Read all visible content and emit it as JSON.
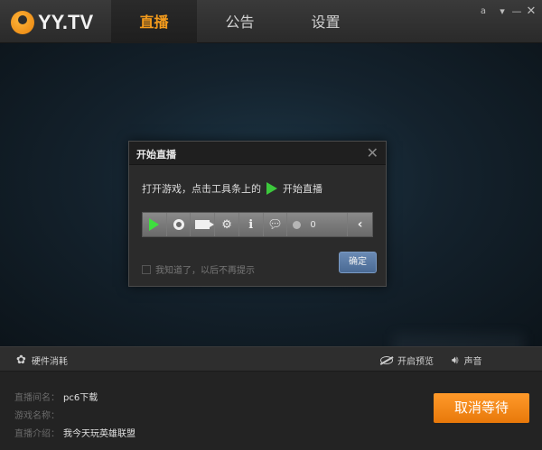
{
  "app": {
    "logo_text": "YY.TV"
  },
  "tabs": [
    {
      "label": "直播",
      "active": true
    },
    {
      "label": "公告",
      "active": false
    },
    {
      "label": "设置",
      "active": false
    }
  ],
  "window_controls": {
    "user": "a",
    "menu": "▾",
    "minimize": "—",
    "close": "✕"
  },
  "dialog": {
    "title": "开始直播",
    "message": "打开游戏，点击工具条上的",
    "message_action": "开始直播",
    "viewer_count": "0",
    "checkbox_label": "我知道了，以后不再提示",
    "confirm_label": "确定"
  },
  "status_bar": {
    "hardware": "硬件消耗",
    "preview": "开启预览",
    "sound": "声音"
  },
  "stream_info": {
    "room_label": "直播间名：",
    "room_value": "pc6下载",
    "game_label": "游戏名称：",
    "game_value": "",
    "intro_label": "直播介绍：",
    "intro_value": "我今天玩英雄联盟"
  },
  "actions": {
    "cancel_label": "取消等待"
  },
  "colors": {
    "accent": "#f39b1c",
    "play_green": "#3ede3e",
    "cancel_bg": "#f5891a"
  }
}
